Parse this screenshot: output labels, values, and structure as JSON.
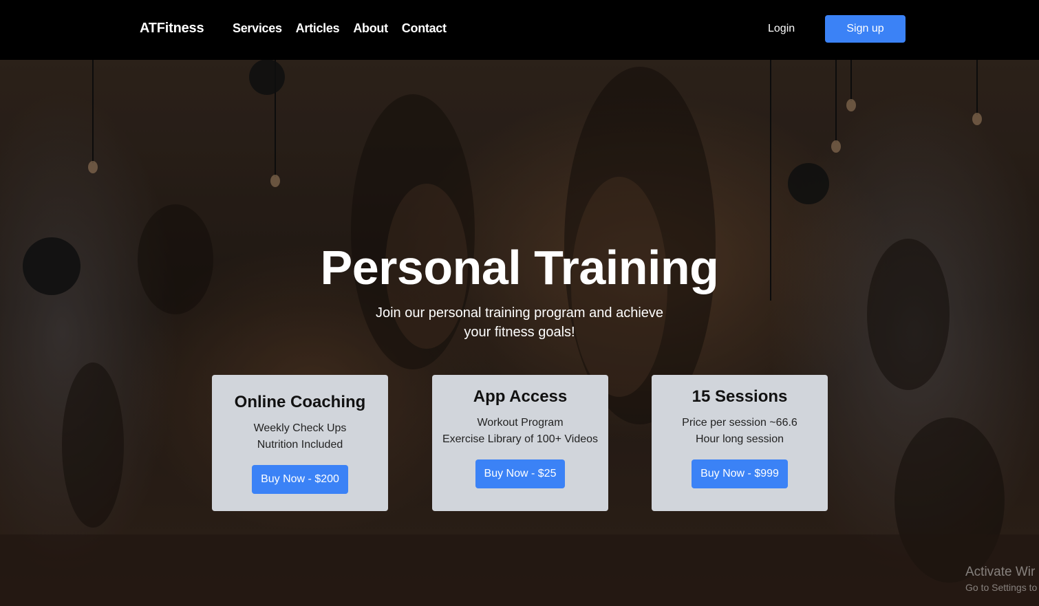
{
  "navbar": {
    "brand": "ATFitness",
    "links": [
      "Services",
      "Articles",
      "About",
      "Contact"
    ],
    "login_label": "Login",
    "signup_label": "Sign up"
  },
  "hero": {
    "title": "Personal Training",
    "subtitle": "Join our personal training program and achieve your fitness goals!"
  },
  "cards": [
    {
      "title": "Online Coaching",
      "lines": [
        "Weekly Check Ups",
        "Nutrition Included"
      ],
      "button": "Buy Now - $200"
    },
    {
      "title": "App Access",
      "lines": [
        "Workout Program",
        "Exercise Library of 100+ Videos"
      ],
      "button": "Buy Now - $25"
    },
    {
      "title": "15 Sessions",
      "lines": [
        "Price per session ~66.6",
        "Hour long session"
      ],
      "button": "Buy Now - $999"
    }
  ],
  "watermark": {
    "title": "Activate Wir",
    "subtitle": "Go to Settings to"
  },
  "colors": {
    "accent": "#3b82f6",
    "card_bg": "#d1d5db",
    "navbar_bg": "#000000"
  }
}
